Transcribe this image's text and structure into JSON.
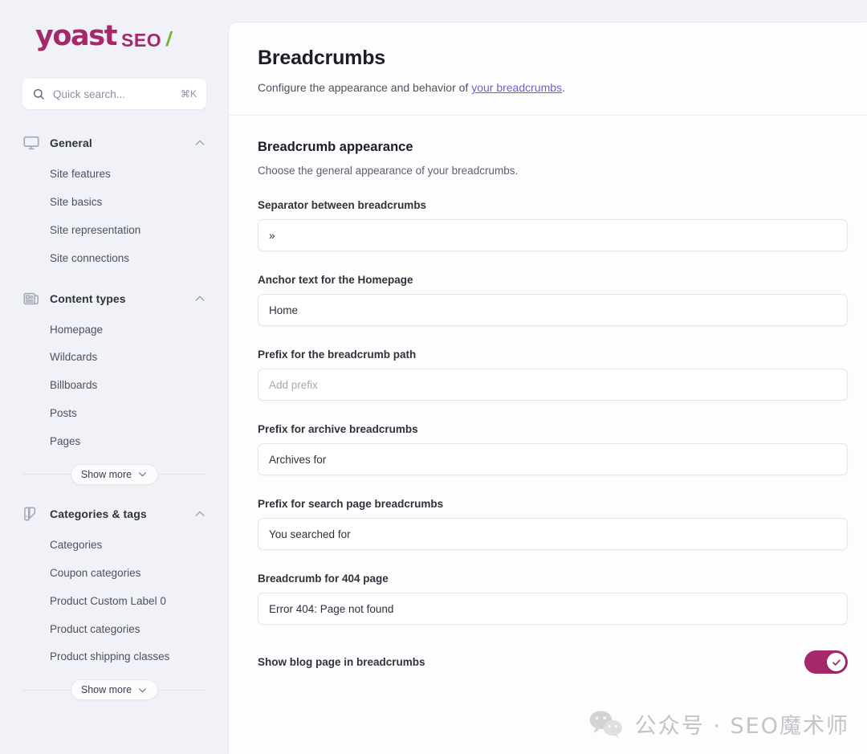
{
  "brand": {
    "name": "yoast",
    "product": "SEO",
    "slash": "/",
    "accent_color": "#a4286a",
    "slash_color": "#77b227"
  },
  "search": {
    "placeholder": "Quick search...",
    "shortcut": "⌘K",
    "icon": "search-icon"
  },
  "sidebar": {
    "groups": [
      {
        "label": "General",
        "icon": "monitor-icon",
        "expanded": true,
        "items": [
          {
            "label": "Site features"
          },
          {
            "label": "Site basics"
          },
          {
            "label": "Site representation"
          },
          {
            "label": "Site connections"
          }
        ],
        "show_more": null
      },
      {
        "label": "Content types",
        "icon": "article-icon",
        "expanded": true,
        "items": [
          {
            "label": "Homepage"
          },
          {
            "label": "Wildcards"
          },
          {
            "label": "Billboards"
          },
          {
            "label": "Posts"
          },
          {
            "label": "Pages"
          }
        ],
        "show_more": "Show more"
      },
      {
        "label": "Categories & tags",
        "icon": "tag-icon",
        "expanded": true,
        "items": [
          {
            "label": "Categories"
          },
          {
            "label": "Coupon categories"
          },
          {
            "label": "Product Custom Label 0"
          },
          {
            "label": "Product categories"
          },
          {
            "label": "Product shipping classes"
          }
        ],
        "show_more": "Show more"
      }
    ]
  },
  "header": {
    "title": "Breadcrumbs",
    "description_before": "Configure the appearance and behavior of ",
    "description_link": "your breadcrumbs",
    "description_after": "."
  },
  "section": {
    "title": "Breadcrumb appearance",
    "description": "Choose the general appearance of your breadcrumbs."
  },
  "fields": [
    {
      "label": "Separator between breadcrumbs",
      "value": "»",
      "placeholder": ""
    },
    {
      "label": "Anchor text for the Homepage",
      "value": "Home",
      "placeholder": ""
    },
    {
      "label": "Prefix for the breadcrumb path",
      "value": "",
      "placeholder": "Add prefix"
    },
    {
      "label": "Prefix for archive breadcrumbs",
      "value": "Archives for",
      "placeholder": ""
    },
    {
      "label": "Prefix for search page breadcrumbs",
      "value": "You searched for",
      "placeholder": ""
    },
    {
      "label": "Breadcrumb for 404 page",
      "value": "Error 404: Page not found",
      "placeholder": ""
    }
  ],
  "toggle_field": {
    "label": "Show blog page in breadcrumbs",
    "checked": true,
    "on_color": "#a4286a"
  },
  "watermark": {
    "text": "公众号 · SEO魔术师",
    "icon": "wechat-icon"
  }
}
